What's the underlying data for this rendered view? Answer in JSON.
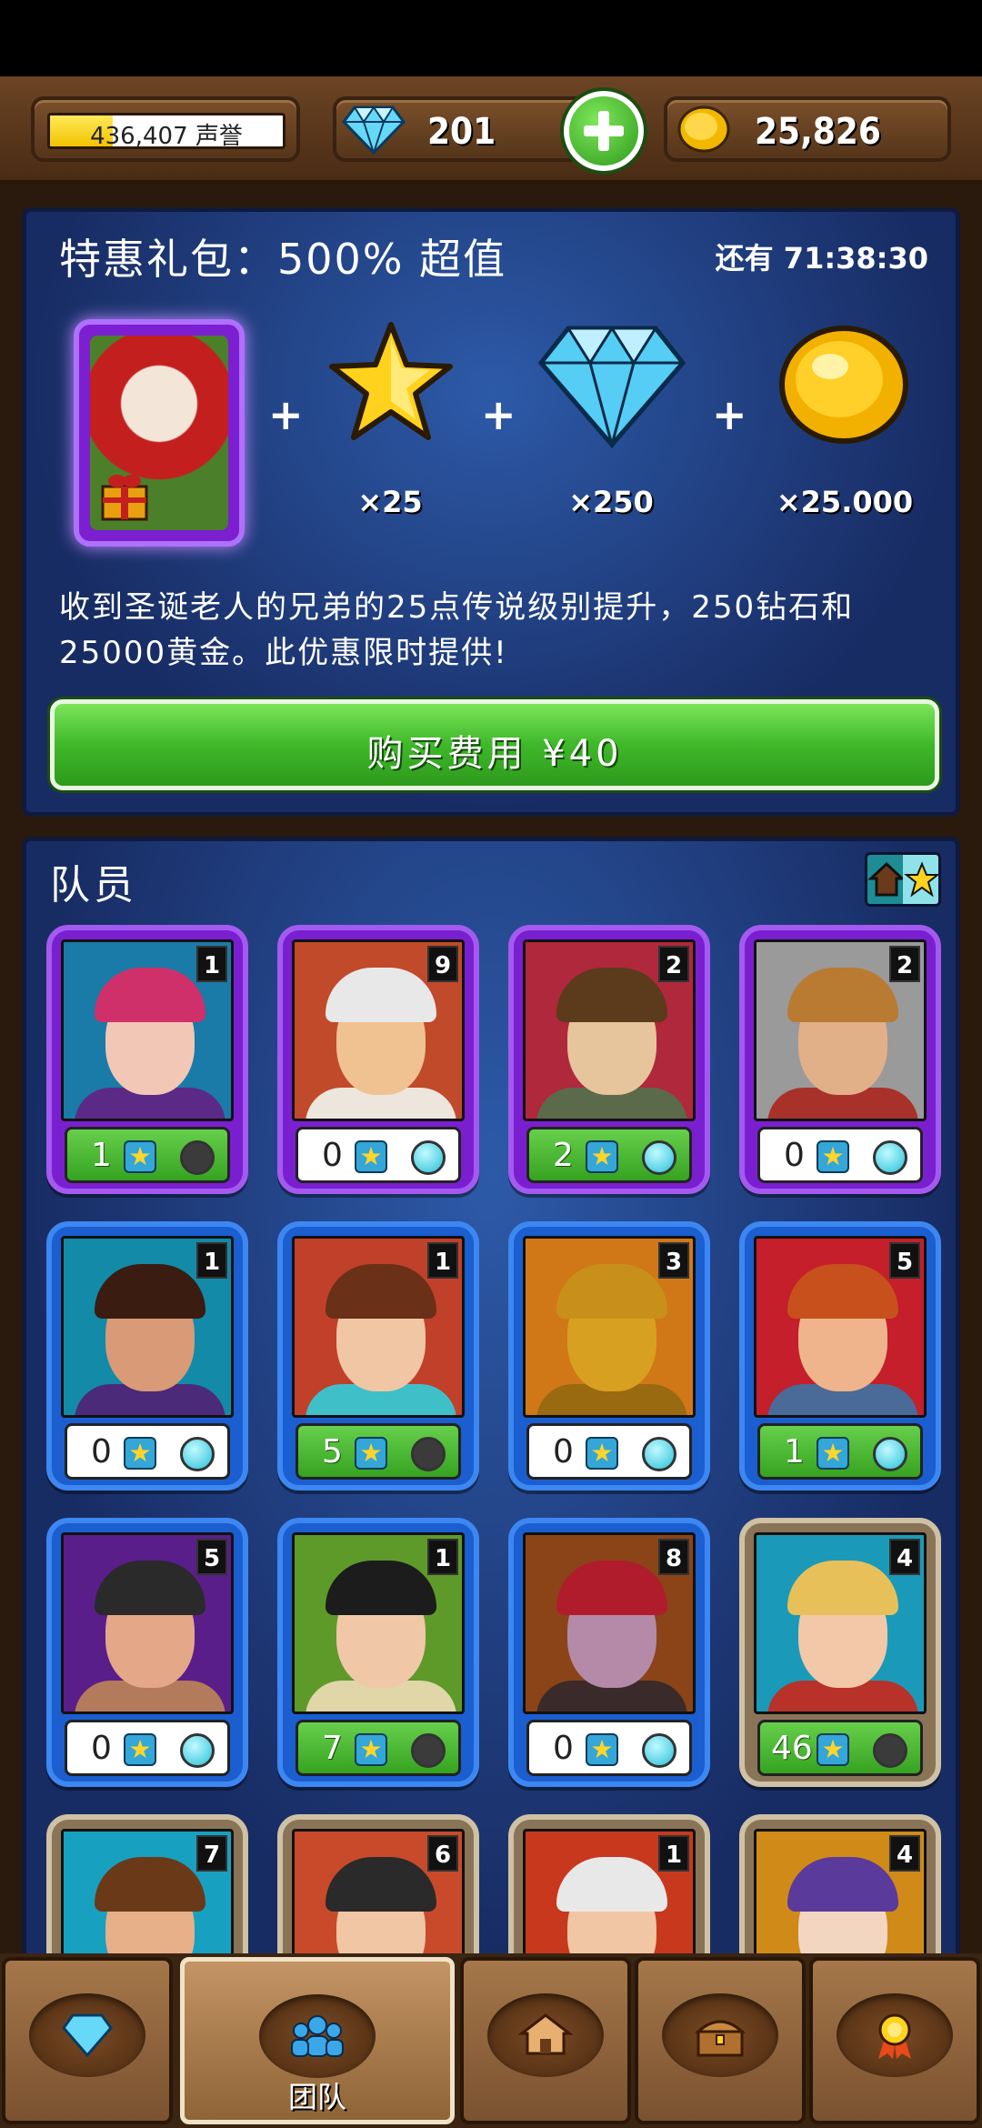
{
  "topbar": {
    "fame_text": "436,407 声誉",
    "fame_progress": 0.27,
    "gems": "201",
    "gold": "25,826"
  },
  "offer": {
    "title": "特惠礼包：500% 超值",
    "timer": "还有 71:38:30",
    "rewards": [
      {
        "icon": "santa-hero-card",
        "label": ""
      },
      {
        "icon": "star-icon",
        "label": "×25"
      },
      {
        "icon": "diamond-icon",
        "label": "×250"
      },
      {
        "icon": "gold-coin-icon",
        "label": "×25.000"
      }
    ],
    "description": "收到圣诞老人的兄弟的25点传说级别提升，250钻石和25000黄金。此优惠限时提供!",
    "buy_label": "购买费用 ¥40"
  },
  "team": {
    "title": "队员",
    "heroes": [
      {
        "rarity": "purple",
        "level": "1",
        "stars": "1",
        "stat_style": "green",
        "dot": "off",
        "bg": "#1a7aa8",
        "skin": "#f2c7b5",
        "hair": "#d0306a",
        "clothes": "#5b2a86"
      },
      {
        "rarity": "purple",
        "level": "9",
        "stars": "0",
        "stat_style": "white",
        "dot": "on",
        "bg": "#c04a2a",
        "skin": "#f1c291",
        "hair": "#e8e8e8",
        "clothes": "#ece6dc"
      },
      {
        "rarity": "purple",
        "level": "2",
        "stars": "2",
        "stat_style": "green",
        "dot": "on",
        "bg": "#b0283c",
        "skin": "#e6c49c",
        "hair": "#5c3a1c",
        "clothes": "#5b6a4a"
      },
      {
        "rarity": "purple",
        "level": "2",
        "stars": "0",
        "stat_style": "white",
        "dot": "on",
        "bg": "#9a9a9a",
        "skin": "#e2b088",
        "hair": "#b97a32",
        "clothes": "#a8322a"
      },
      {
        "rarity": "blue",
        "level": "1",
        "stars": "0",
        "stat_style": "white",
        "dot": "on",
        "bg": "#128aa8",
        "skin": "#d99a78",
        "hair": "#3a1c10",
        "clothes": "#4b2a7a"
      },
      {
        "rarity": "blue",
        "level": "1",
        "stars": "5",
        "stat_style": "green",
        "dot": "off",
        "bg": "#c0402a",
        "skin": "#f1c6a4",
        "hair": "#6a3018",
        "clothes": "#3fc0c8"
      },
      {
        "rarity": "blue",
        "level": "3",
        "stars": "0",
        "stat_style": "white",
        "dot": "on",
        "bg": "#d07818",
        "skin": "#d8a020",
        "hair": "#c8901a",
        "clothes": "#9a6a10"
      },
      {
        "rarity": "blue",
        "level": "5",
        "stars": "1",
        "stat_style": "green",
        "dot": "on",
        "bg": "#c41f2a",
        "skin": "#f0b48c",
        "hair": "#c8501c",
        "clothes": "#4a6a98"
      },
      {
        "rarity": "blue",
        "level": "5",
        "stars": "0",
        "stat_style": "white",
        "dot": "on",
        "bg": "#5a1e8a",
        "skin": "#e4a888",
        "hair": "#2a2a2a",
        "clothes": "#b47a5c"
      },
      {
        "rarity": "blue",
        "level": "1",
        "stars": "7",
        "stat_style": "green",
        "dot": "off",
        "bg": "#5e9a2a",
        "skin": "#f0c8a8",
        "hair": "#1c1c1c",
        "clothes": "#e0d6a8"
      },
      {
        "rarity": "blue",
        "level": "8",
        "stars": "0",
        "stat_style": "white",
        "dot": "on",
        "bg": "#8a4418",
        "skin": "#b48aa8",
        "hair": "#b01c2c",
        "clothes": "#3a2a2a"
      },
      {
        "rarity": "tan",
        "level": "4",
        "stars": "46",
        "stat_style": "green",
        "dot": "off",
        "bg": "#1a9ab8",
        "skin": "#f2c8a8",
        "hair": "#e8c05a",
        "clothes": "#b8322a"
      },
      {
        "rarity": "tan",
        "level": "7",
        "stars": "",
        "stat_style": "none",
        "dot": "none",
        "bg": "#18a0c0",
        "skin": "#e8b088",
        "hair": "#6a3a18",
        "clothes": "#5a3a20"
      },
      {
        "rarity": "tan",
        "level": "6",
        "stars": "",
        "stat_style": "none",
        "dot": "none",
        "bg": "#c84a2a",
        "skin": "#f1c6a4",
        "hair": "#2a2a2a",
        "clothes": "#e8d0a0"
      },
      {
        "rarity": "tan",
        "level": "1",
        "stars": "",
        "stat_style": "none",
        "dot": "none",
        "bg": "#c8381c",
        "skin": "#f1c6a4",
        "hair": "#e8e8e8",
        "clothes": "#3a6a2a"
      },
      {
        "rarity": "tan",
        "level": "4",
        "stars": "",
        "stat_style": "none",
        "dot": "none",
        "bg": "#d08a18",
        "skin": "#f2d6c0",
        "hair": "#5a3a9a",
        "clothes": "#3a2a2a"
      }
    ]
  },
  "nav": {
    "tabs": [
      {
        "icon": "diamond-icon",
        "label": ""
      },
      {
        "icon": "team-icon",
        "label": "团队"
      },
      {
        "icon": "shop-icon",
        "label": ""
      },
      {
        "icon": "chest-icon",
        "label": ""
      },
      {
        "icon": "medal-icon",
        "label": ""
      }
    ]
  },
  "colors": {
    "panel_blue": "#1f3f86",
    "button_green": "#3fb82a",
    "wood": "#6b4424"
  }
}
